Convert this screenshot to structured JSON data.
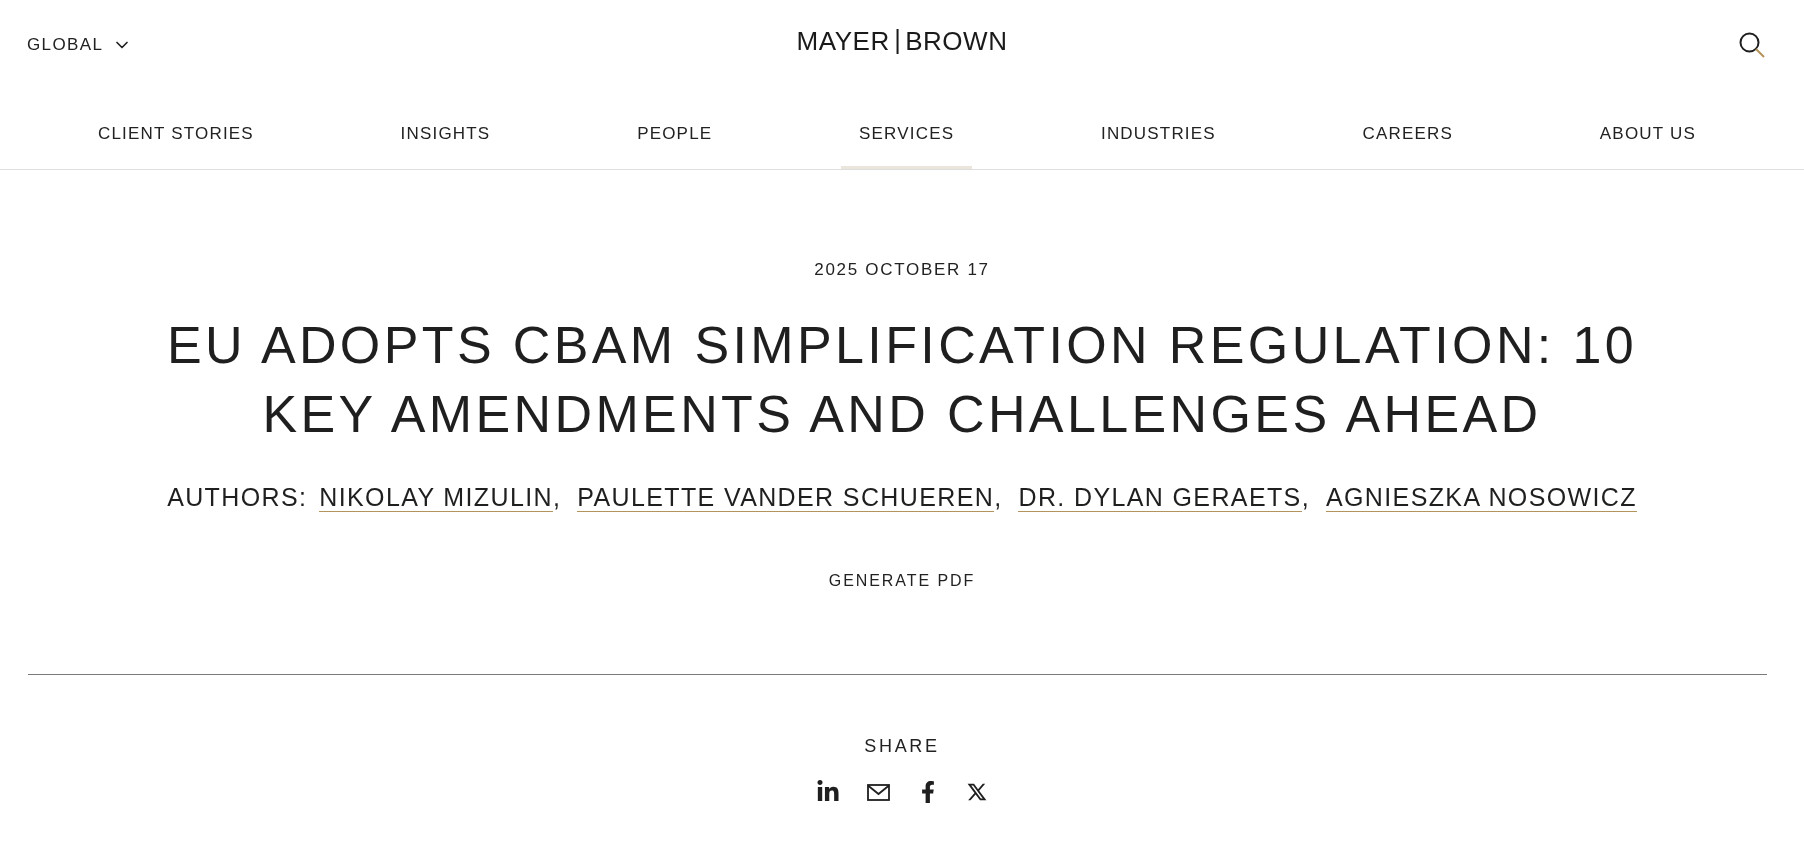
{
  "header": {
    "region_selector": {
      "label": "GLOBAL"
    },
    "logo": {
      "left": "MAYER",
      "right": "BROWN"
    }
  },
  "nav": [
    {
      "label": "CLIENT STORIES",
      "selected": false
    },
    {
      "label": "INSIGHTS",
      "selected": false
    },
    {
      "label": "PEOPLE",
      "selected": false
    },
    {
      "label": "SERVICES",
      "selected": true
    },
    {
      "label": "INDUSTRIES",
      "selected": false
    },
    {
      "label": "CAREERS",
      "selected": false
    },
    {
      "label": "ABOUT US",
      "selected": false
    }
  ],
  "article": {
    "date": "2025 OCTOBER 17",
    "title": "EU ADOPTS CBAM SIMPLIFICATION REGULATION: 10 KEY AMENDMENTS AND CHALLENGES AHEAD",
    "authors_label": "AUTHORS:",
    "authors": [
      {
        "name": "NIKOLAY MIZULIN",
        "separator": ","
      },
      {
        "name": "PAULETTE VANDER SCHUEREN",
        "separator": ","
      },
      {
        "name": "DR. DYLAN GERAETS",
        "separator": ","
      },
      {
        "name": "AGNIESZKA NOSOWICZ"
      }
    ],
    "generate_pdf": "GENERATE PDF"
  },
  "share": {
    "label": "SHARE",
    "buttons": [
      {
        "kind": "linkedin"
      },
      {
        "kind": "email"
      },
      {
        "kind": "facebook"
      },
      {
        "kind": "x"
      }
    ]
  }
}
